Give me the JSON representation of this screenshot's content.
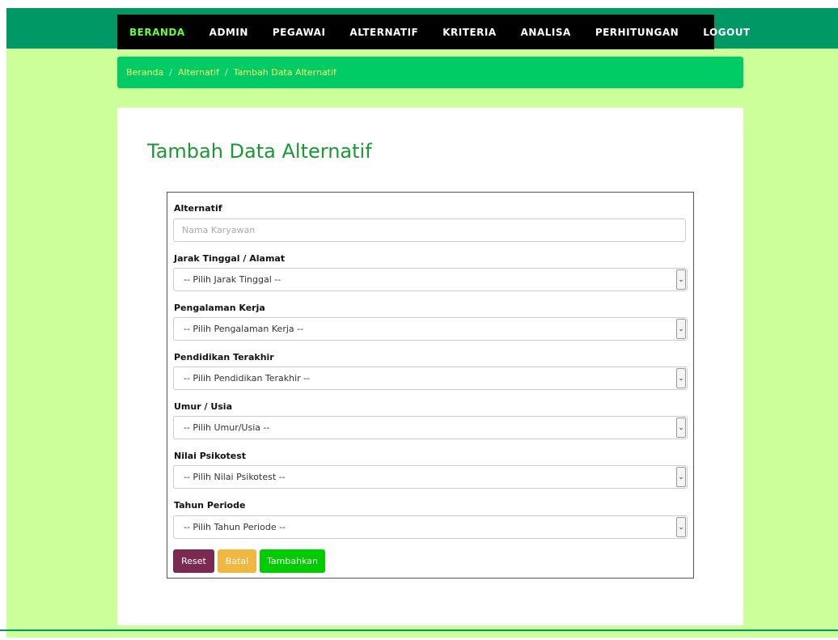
{
  "nav": {
    "items": [
      {
        "label": "BERANDA",
        "active": true
      },
      {
        "label": "ADMIN",
        "active": false
      },
      {
        "label": "PEGAWAI",
        "active": false
      },
      {
        "label": "ALTERNATIF",
        "active": false
      },
      {
        "label": "KRITERIA",
        "active": false
      },
      {
        "label": "ANALISA",
        "active": false
      },
      {
        "label": "PERHITUNGAN",
        "active": false
      },
      {
        "label": "LOGOUT",
        "active": false
      }
    ]
  },
  "breadcrumb": {
    "items": [
      "Beranda",
      "Alternatif",
      "Tambah Data Alternatif"
    ],
    "separator": "/"
  },
  "page": {
    "title": "Tambah Data Alternatif"
  },
  "form": {
    "alternatif": {
      "label": "Alternatif",
      "placeholder": "Nama Karyawan",
      "value": ""
    },
    "jarak": {
      "label": "Jarak Tinggal / Alamat",
      "selected": "-- Pilih Jarak Tinggal --"
    },
    "pengalaman": {
      "label": "Pengalaman Kerja",
      "selected": "-- Pilih Pengalaman Kerja --"
    },
    "pendidikan": {
      "label": "Pendidikan Terakhir",
      "selected": "-- Pilih Pendidikan Terakhir --"
    },
    "umur": {
      "label": "Umur / Usia",
      "selected": "-- Pilih Umur/Usia --"
    },
    "psikotest": {
      "label": "Nilai Psikotest",
      "selected": "-- Pilih Nilai Psikotest --"
    },
    "tahun": {
      "label": "Tahun Periode",
      "selected": "-- Pilih Tahun Periode --"
    },
    "buttons": {
      "reset": "Reset",
      "batal": "Batal",
      "tambahkan": "Tambahkan"
    }
  },
  "colors": {
    "background": "#ccff99",
    "header_band": "#009966",
    "navbar": "#000000",
    "nav_active": "#66ff33",
    "breadcrumb_bg": "#00cc66",
    "title": "#1a9933",
    "reset_button": "#7a2951",
    "batal_button": "#f0b840",
    "tambahkan_button": "#00cc00"
  }
}
